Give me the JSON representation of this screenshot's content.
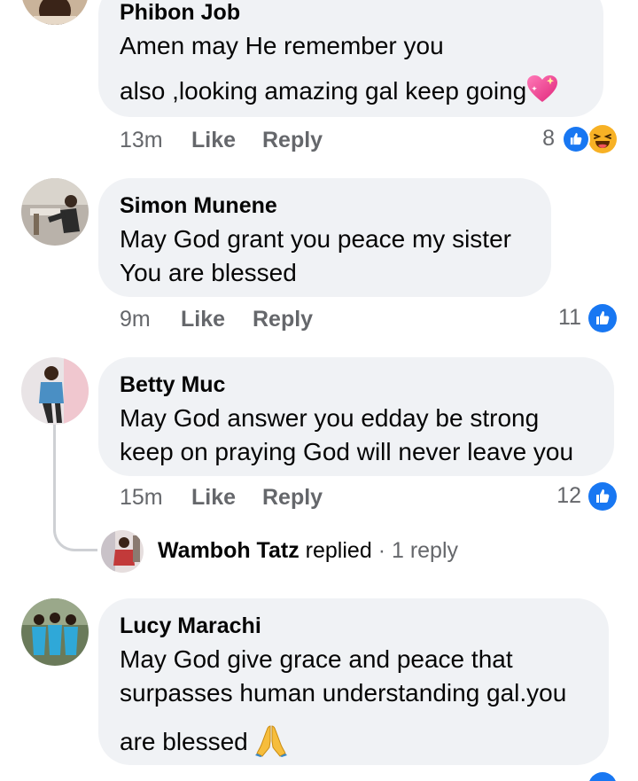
{
  "comments": [
    {
      "author": "Phibon Job",
      "lines": [
        "Amen may He remember you",
        "also ,looking amazing gal keep going"
      ],
      "emoji": "sparkling-heart",
      "time": "13m",
      "like_label": "Like",
      "reply_label": "Reply",
      "reaction_count": "8",
      "reactions": [
        "like-icon",
        "haha-icon"
      ]
    },
    {
      "author": "Simon Munene",
      "lines": [
        "May God grant you peace my sister",
        "You are blessed"
      ],
      "time": "9m",
      "like_label": "Like",
      "reply_label": "Reply",
      "reaction_count": "11",
      "reactions": [
        "like-icon"
      ]
    },
    {
      "author": "Betty Muc",
      "lines": [
        "May God answer you edday be strong",
        "keep on praying God will never leave you"
      ],
      "time": "15m",
      "like_label": "Like",
      "reply_label": "Reply",
      "reaction_count": "12",
      "reactions": [
        "like-icon"
      ],
      "reply_summary": {
        "name": "Wamboh Tatz",
        "verb": "replied",
        "separator": "·",
        "count": "1 reply"
      }
    },
    {
      "author": "Lucy Marachi",
      "lines": [
        "May God give grace and peace that",
        "surpasses human understanding gal.you",
        "are blessed"
      ],
      "emoji": "folded-hands",
      "reactions": [
        "like-icon"
      ]
    }
  ],
  "colors": {
    "bubble": "#f0f2f5",
    "meta_text": "#65676b",
    "like_blue": "#1877f2",
    "haha_yellow": "#f7b125",
    "thread_line": "#ced0d4"
  }
}
